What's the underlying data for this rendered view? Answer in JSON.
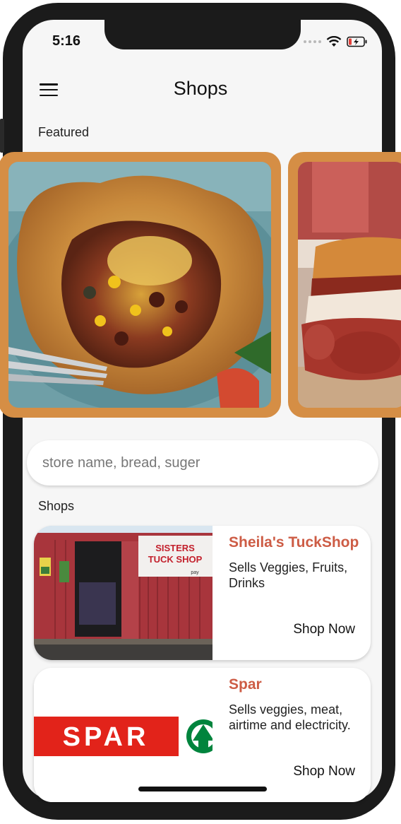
{
  "status_bar": {
    "time": "5:16",
    "icons": [
      "signal-dots-icon",
      "wifi-icon",
      "battery-charging-icon"
    ]
  },
  "header": {
    "title": "Shops",
    "menu_icon": "hamburger-menu-icon"
  },
  "featured": {
    "label": "Featured",
    "cards": [
      {
        "image": "savory pie with beans and cheese"
      },
      {
        "image": "toasted sandwich"
      }
    ],
    "border_color": "#d58e45"
  },
  "search": {
    "placeholder": "store name, bread, suger",
    "value": ""
  },
  "shops": {
    "label": "Shops",
    "items": [
      {
        "name": "Sheila's TuckShop",
        "description": "Sells Veggies, Fruits, Drinks",
        "action": "Shop Now",
        "image_text_1": "SISTERS",
        "image_text_2": "TUCK SHOP",
        "image_text_3": "pay"
      },
      {
        "name": "Spar",
        "description": "Sells veggies, meat, airtime and electricity.",
        "action": "Shop Now",
        "logo_text": "SPAR"
      }
    ]
  },
  "colors": {
    "accent": "#cd5c45",
    "featured_border": "#d58e45",
    "spar_red": "#e2231a",
    "spar_green": "#00843d"
  }
}
